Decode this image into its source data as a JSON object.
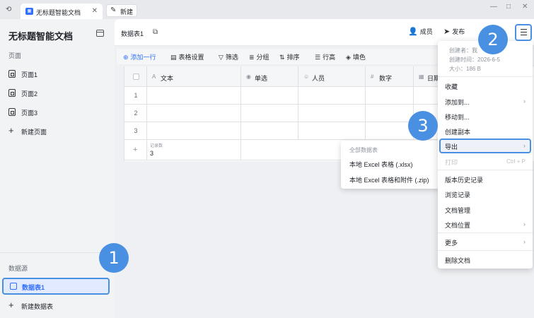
{
  "titlebar": {
    "tab_title": "无标题智能文档",
    "new_tab_label": "新建",
    "win_minimize": "—",
    "win_maximize": "□",
    "win_close": "✕"
  },
  "sidebar": {
    "title": "无标题智能文档",
    "pages_heading": "页面",
    "pages": [
      {
        "label": "页面1"
      },
      {
        "label": "页面2"
      },
      {
        "label": "页面3"
      }
    ],
    "new_page_label": "新建页面",
    "datasource_heading": "数据源",
    "datasource_active": "数据表1",
    "new_datasource_label": "新建数据表"
  },
  "header": {
    "doc_name": "数据表1",
    "members_label": "成员",
    "publish_label": "发布"
  },
  "toolbar": {
    "add_row": "添加一行",
    "table_settings": "表格设置",
    "filter": "筛选",
    "group": "分组",
    "sort": "排序",
    "row_height": "行高",
    "fill_color": "填色"
  },
  "grid": {
    "columns": [
      "文本",
      "单选",
      "人员",
      "数字",
      "日期"
    ],
    "rows": [
      "1",
      "2",
      "3"
    ],
    "footer_label": "记录数",
    "footer_value": "3"
  },
  "export_submenu": {
    "heading": "全部数据表",
    "items": [
      "本地 Excel 表格 (.xlsx)",
      "本地 Excel 表格和附件 (.zip)"
    ]
  },
  "more_menu": {
    "creator": "创建者：我",
    "created_time": "创建时间：2026-6-5",
    "size": "大小：186 B",
    "items": {
      "favorite": "收藏",
      "add_to": "添加到...",
      "move_to": "移动到...",
      "create_copy": "创建副本",
      "export": "导出",
      "print": "打印",
      "print_shortcut": "Ctrl + P",
      "version_history": "版本历史记录",
      "browse_history": "浏览记录",
      "doc_manage": "文档管理",
      "doc_location": "文档位置",
      "more": "更多",
      "delete": "删除文档"
    }
  },
  "callouts": {
    "one": "1",
    "two": "2",
    "three": "3"
  },
  "colors": {
    "accent": "#3370ff",
    "callout": "#4a90e2"
  }
}
